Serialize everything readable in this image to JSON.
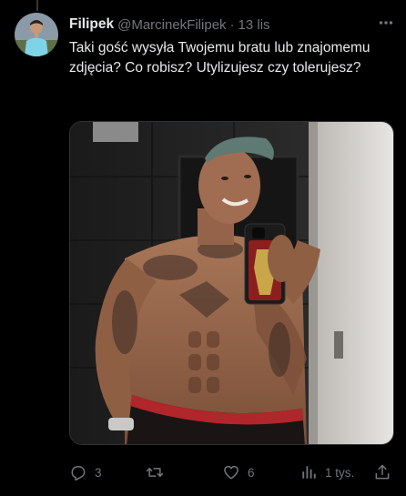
{
  "tweet": {
    "author": {
      "display_name": "Filipek",
      "handle": "@MarcinekFilipek",
      "avatar_icon": "avatar-photo"
    },
    "separator": "·",
    "timestamp": "13 lis",
    "text": "Taki gość wysyła Twojemu bratu lub znajomemu zdjęcia? Co robisz? Utylizujesz czy tolerujesz?",
    "media": {
      "kind": "photo",
      "subject": "mirror-selfie"
    },
    "actions": {
      "reply_count": "3",
      "retweet_count": "",
      "like_count": "6",
      "views_count": "1 tys."
    }
  },
  "colors": {
    "background": "#000000",
    "text_primary": "#e7e9ea",
    "text_secondary": "#71767b",
    "border": "#2f3336"
  }
}
